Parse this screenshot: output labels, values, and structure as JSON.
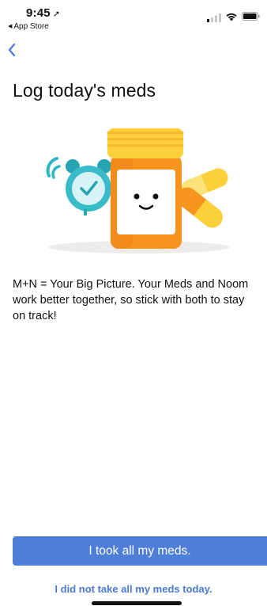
{
  "status_bar": {
    "time": "9:45",
    "location_arrow": "➚",
    "back_to_app_label": "App Store",
    "back_to_app_icon": "◀",
    "icons": [
      "cellular-signal-icon",
      "wifi-icon",
      "battery-icon"
    ]
  },
  "nav": {
    "back_icon": "chevron-left-icon"
  },
  "page": {
    "title": "Log today's meds",
    "body": "M+N = Your Big Picture. Your Meds and Noom work better together, so stick with both to stay on track!"
  },
  "illustration": {
    "description_icons": [
      "alarm-clock-icon",
      "pill-bottle-icon",
      "capsule-icon"
    ]
  },
  "actions": {
    "primary_label": "I took all my meds.",
    "secondary_label": "I did not take all my meds today."
  },
  "colors": {
    "accent": "#4f7ed8",
    "link": "#4a7ad6",
    "bottle_orange": "#f7941d",
    "bottle_yellow": "#fbd03a",
    "clock_teal": "#2bb6c4"
  }
}
